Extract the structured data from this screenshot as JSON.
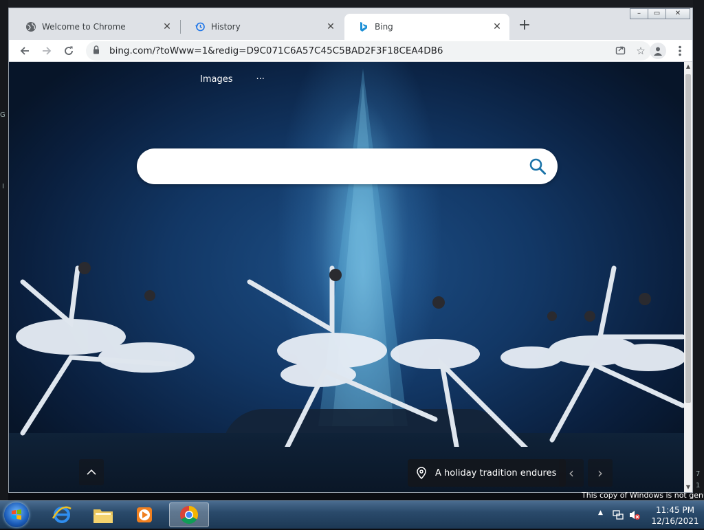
{
  "browser": {
    "tabs": [
      {
        "label": "Welcome to Chrome",
        "icon": "globe-icon",
        "active": false
      },
      {
        "label": "History",
        "icon": "history-icon",
        "active": false
      },
      {
        "label": "Bing",
        "icon": "bing-logo-icon",
        "active": true
      }
    ],
    "new_tab_label": "+",
    "window_controls": {
      "minimize": "–",
      "maximize": "▭",
      "close": "✕"
    },
    "url": "bing.com/?toWww=1&redig=D9C071C6A57C45C5BAD2F3F18CEA4DB6"
  },
  "page": {
    "nav": {
      "images_label": "Images",
      "more_label": "···"
    },
    "search": {
      "placeholder": ""
    },
    "caption": "A holiday tradition endures",
    "prev_label": "‹",
    "next_label": "›",
    "up_label": "^"
  },
  "desktop": {
    "left_glyph_1": "G",
    "left_glyph_2": "I",
    "right_glyph_1": "7",
    "right_glyph_2": "1"
  },
  "taskbar": {
    "time": "11:45 PM",
    "date": "12/16/2021",
    "genuine_notice": "This copy of Windows is not genuine"
  },
  "colors": {
    "bing_accent": "#1a73a8",
    "tab_active_bg": "#ffffff",
    "tabstrip_bg": "#dee1e6"
  }
}
